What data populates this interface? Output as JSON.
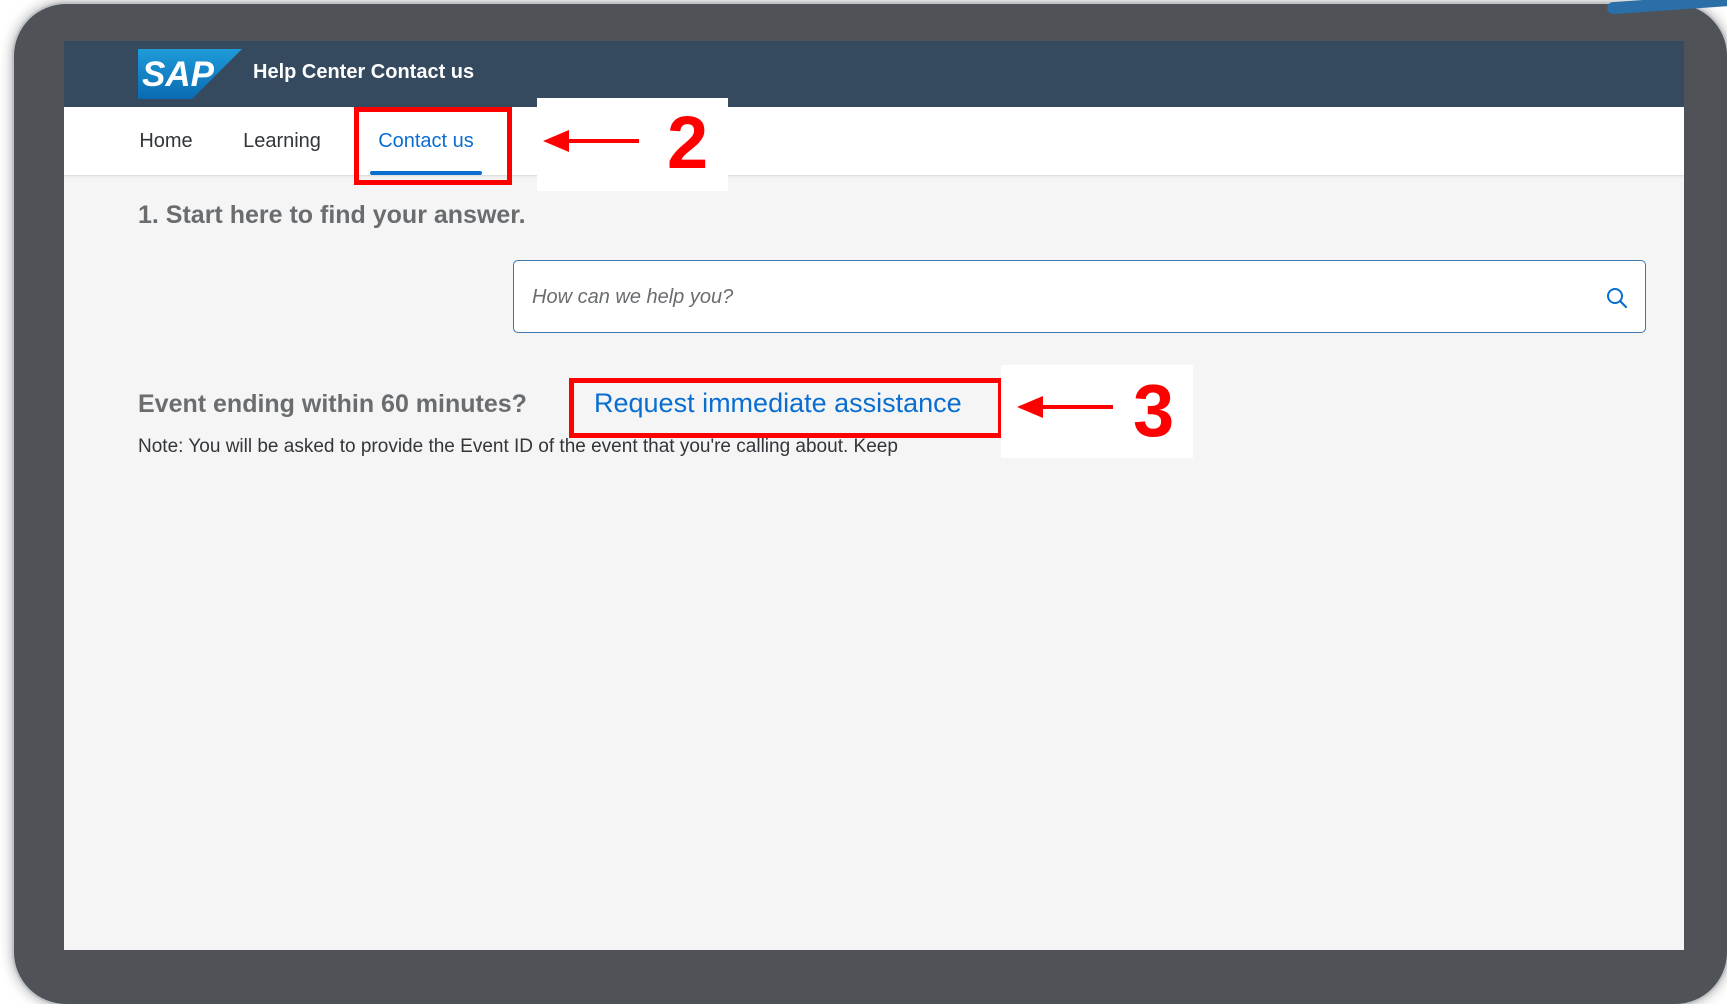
{
  "app": {
    "title": "Help Center Contact us",
    "logo_text": "SAP"
  },
  "tabs": [
    {
      "label": "Home",
      "active": false
    },
    {
      "label": "Learning",
      "active": false
    },
    {
      "label": "Contact us",
      "active": true
    }
  ],
  "main": {
    "heading": "1. Start here to find your answer.",
    "search": {
      "placeholder": "How can we help you?",
      "value": ""
    },
    "event_question": "Event ending within 60 minutes?",
    "assist_link": "Request immediate assistance",
    "note": "Note: You will be asked to provide the Event ID of the event that you're calling about. Keep"
  },
  "annotations": [
    {
      "number": "2",
      "target": "Contact us"
    },
    {
      "number": "3",
      "target": "Request immediate assistance"
    }
  ],
  "colors": {
    "shell_bar": "#354a5f",
    "accent": "#0a6ed1",
    "annotation": "#ff0000",
    "frame": "#4f5256"
  },
  "icons": {
    "search": "search-icon",
    "arrow": "arrow-left-icon"
  }
}
